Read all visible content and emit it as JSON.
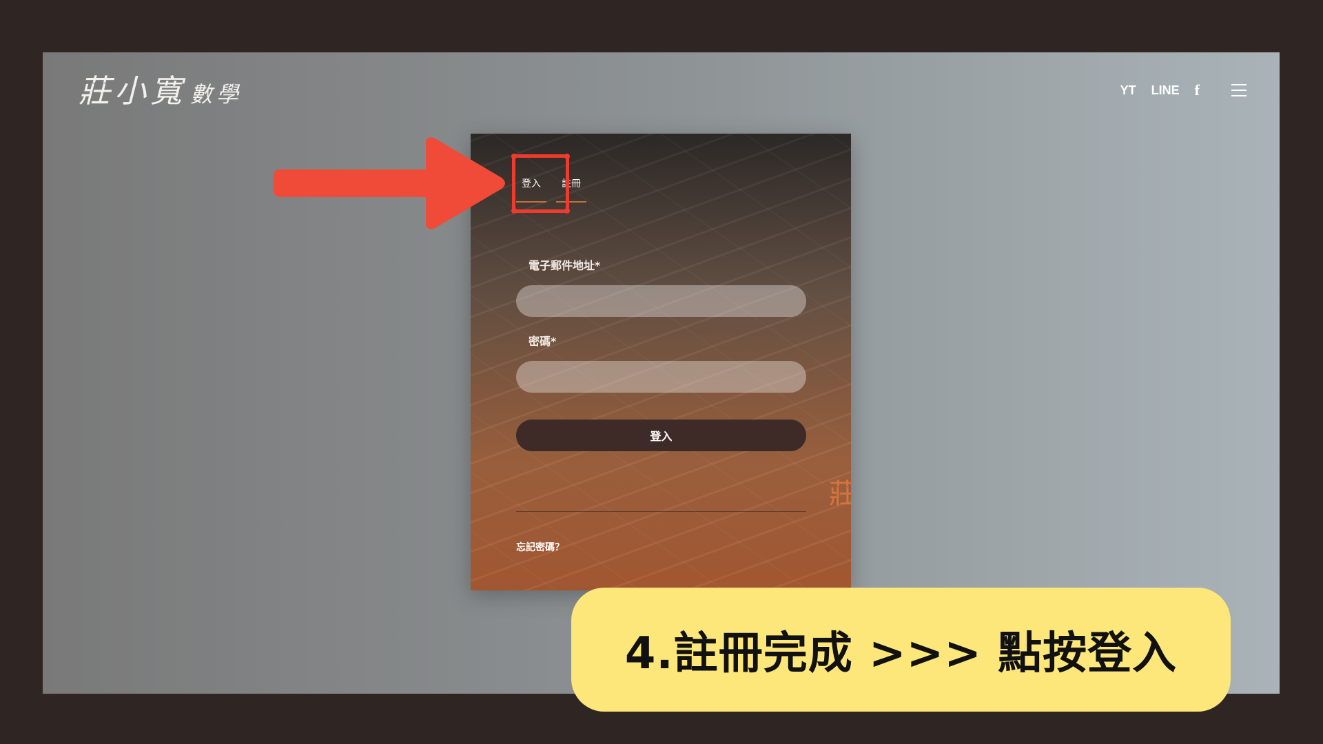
{
  "header": {
    "logo_main": "莊小寬",
    "logo_sub": "數學",
    "nav": [
      "YT",
      "LINE"
    ],
    "facebook_glyph": "f"
  },
  "login_form": {
    "tabs": [
      {
        "label": "登入",
        "active": true
      },
      {
        "label": "註冊",
        "active": false
      }
    ],
    "email_label": "電子郵件地址*",
    "email_value": "",
    "password_label": "密碼*",
    "password_value": "",
    "submit_label": "登入",
    "forgot_link": "忘記密碼？",
    "watermark": "莊"
  },
  "annotation": {
    "callout_text": "4.註冊完成  >>> 點按登入",
    "arrow_color": "#f04a38",
    "highlight_color": "#ef3b2e",
    "callout_bg": "#fde67a"
  },
  "colors": {
    "frame": "#2f2624",
    "tab_underline": "#c36f3f",
    "button_bg": "#3e2a27"
  }
}
